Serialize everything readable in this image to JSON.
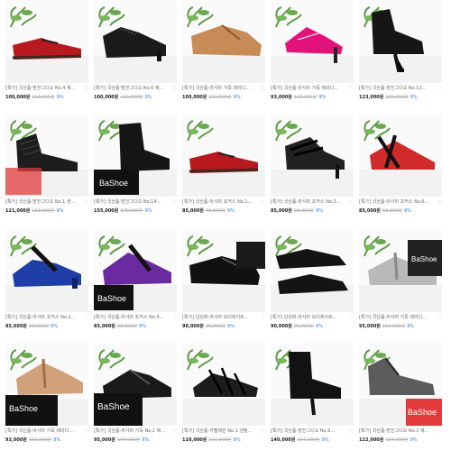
{
  "colors": {
    "accent": "#2a7ae2"
  },
  "products": [
    {
      "title": "[특가] 국산품-방진그디오 No.4 제...",
      "price_now": "100,000원",
      "price_old": "110,000원",
      "discount": "9%",
      "shoe": "red-lace",
      "icon": "heart-icon"
    },
    {
      "title": "[특가] 국산품-방진그디오 No.6 제...",
      "price_now": "100,000원",
      "price_old": "110,000원",
      "discount": "9%",
      "shoe": "black-lace",
      "icon": "heart-icon"
    },
    {
      "title": "[특가] 국산품-라샤라 가죽 레라디...",
      "price_now": "100,000원",
      "price_old": "110,000원",
      "discount": "9%",
      "shoe": "tan-pump",
      "icon": "heart-icon"
    },
    {
      "title": "[특가] 국산품-라샤라 가죽 레라디...",
      "price_now": "93,000원",
      "price_old": "110,000원",
      "discount": "9%",
      "shoe": "pink-sandal",
      "icon": "heart-icon"
    },
    {
      "title": "[특가] 국산품-방진그디오 No.12...",
      "price_now": "123,000원",
      "price_old": "135,000원",
      "discount": "9%",
      "shoe": "black-boot",
      "icon": "heart-icon"
    },
    {
      "title": "[특가] 국산품-방진그디오 No.1 샌...",
      "price_now": "121,000원",
      "price_old": "133,000원",
      "discount": "9%",
      "shoe": "black-mesh",
      "icon": "heart-icon"
    },
    {
      "title": "[특가] 국산품-방진그디오 No.14...",
      "price_now": "155,000원",
      "price_old": "170,000원",
      "discount": "9%",
      "shoe": "black-ankle",
      "icon": "heart-icon"
    },
    {
      "title": "[특가] 국산품-라샤라 조커스 No.1...",
      "price_now": "85,000원",
      "price_old": "93,000원",
      "discount": "9%",
      "shoe": "red-lace",
      "icon": "heart-icon"
    },
    {
      "title": "[특가] 국산품-라샤라 조커스 No.3...",
      "price_now": "85,000원",
      "price_old": "93,000원",
      "discount": "9%",
      "shoe": "black-sandal",
      "icon": "heart-icon"
    },
    {
      "title": "[특가] 국산품-라샤라 조커스 No.6...",
      "price_now": "85,000원",
      "price_old": "93,000원",
      "discount": "9%",
      "shoe": "red-strap",
      "icon": "heart-icon"
    },
    {
      "title": "[특가] 국산품-라샤라 조커스 No.2...",
      "price_now": "85,000원",
      "price_old": "93,000원",
      "discount": "9%",
      "shoe": "blue-suede",
      "icon": "heart-icon"
    },
    {
      "title": "[특가] 국산품-라샤라 조커스 No.4...",
      "price_now": "85,000원",
      "price_old": "93,000원",
      "discount": "9%",
      "shoe": "purple-suede",
      "icon": "heart-icon"
    },
    {
      "title": "[특가] 남성화-라샤라 모더레이트...",
      "price_now": "90,000원",
      "price_old": "99,000원",
      "discount": "9%",
      "shoe": "black-men",
      "icon": "heart-icon"
    },
    {
      "title": "[특가] 남성화-라샤라 모더레이트...",
      "price_now": "90,000원",
      "price_old": "99,000원",
      "discount": "9%",
      "shoe": "black-men2",
      "icon": "heart-icon"
    },
    {
      "title": "[특가] 국산품-라샤라 가죽 레라디...",
      "price_now": "95,000원",
      "price_old": "104,000원",
      "discount": "9%",
      "shoe": "silver-tstrap",
      "icon": "heart-icon"
    },
    {
      "title": "[특가] 국산품-라샤라 가죽 레라디...",
      "price_now": "93,000원",
      "price_old": "102,000원",
      "discount": "9%",
      "shoe": "tan-tstrap",
      "icon": "heart-icon"
    },
    {
      "title": "[특가] 국산품-라샤라 가죽 No.2 제...",
      "price_now": "95,000원",
      "price_old": "104,000원",
      "discount": "9%",
      "shoe": "black-pump",
      "icon": "heart-icon"
    },
    {
      "title": "[특가] 국산품-카멜레온 No.1 샌들...",
      "price_now": "110,000원",
      "price_old": "121,000원",
      "discount": "9%",
      "shoe": "black-strappy",
      "icon": "heart-icon"
    },
    {
      "title": "[특가] 국산품-방진그디오 No.9...",
      "price_now": "140,000원",
      "price_old": "154,000원",
      "discount": "9%",
      "shoe": "black-bootie",
      "icon": "heart-icon"
    },
    {
      "title": "[특가] 국산품-방진그디오 No.3 제...",
      "price_now": "122,000원",
      "price_old": "134,000원",
      "discount": "9%",
      "shoe": "grey-lace",
      "icon": "heart-icon"
    }
  ]
}
